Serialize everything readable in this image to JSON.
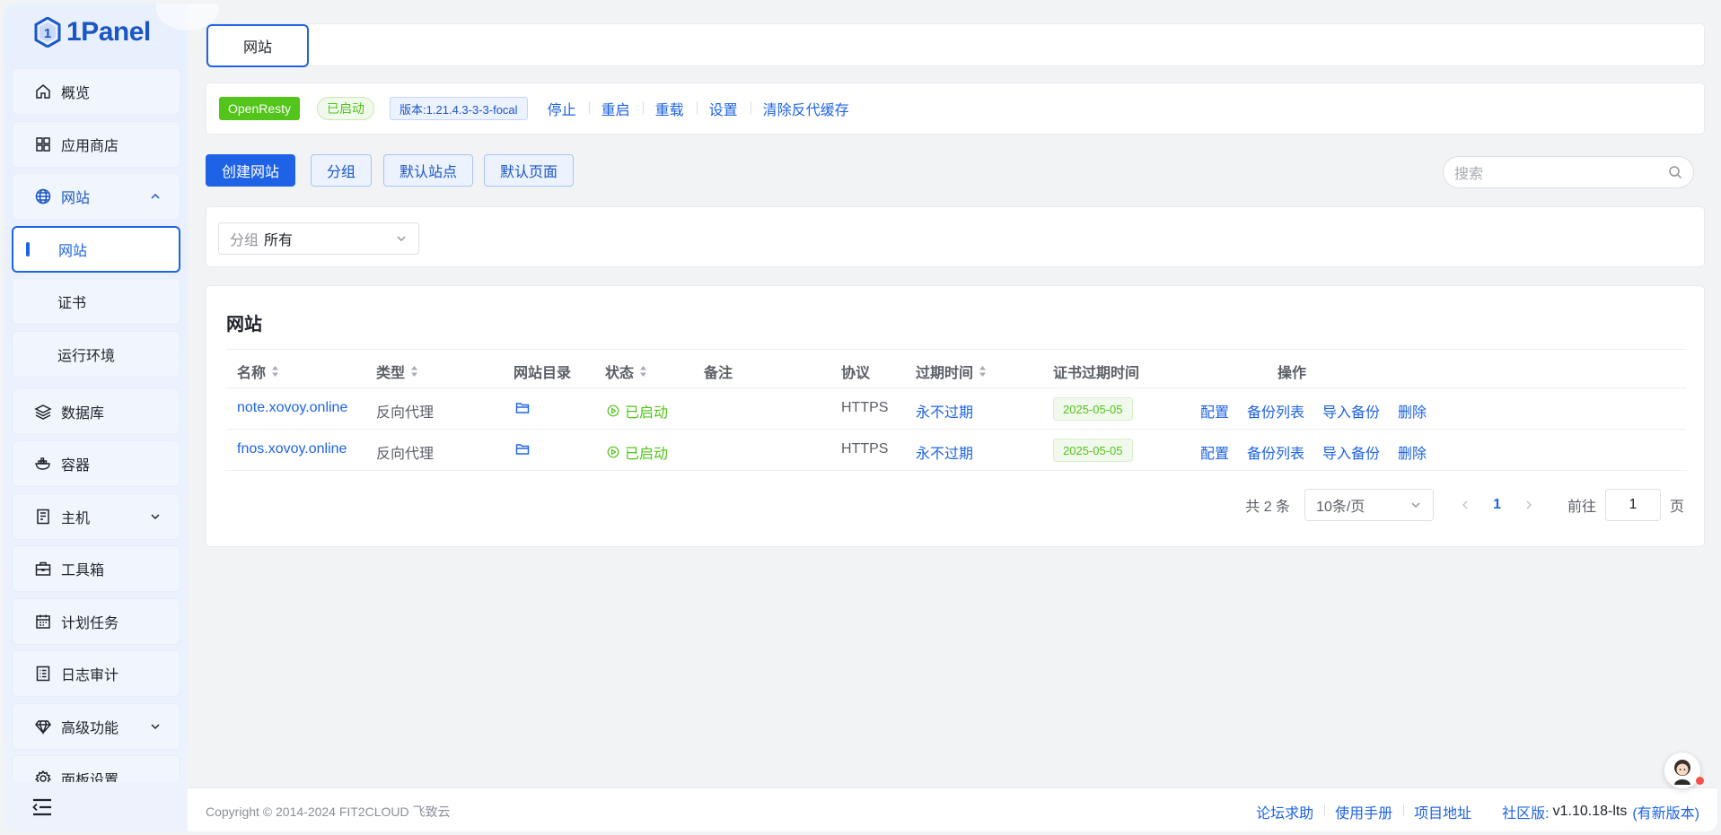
{
  "sidebar": {
    "logo_text": "1Panel",
    "items": [
      {
        "label": "概览",
        "icon": "home-icon"
      },
      {
        "label": "应用商店",
        "icon": "grid-icon"
      },
      {
        "label": "网站",
        "icon": "globe-icon"
      },
      {
        "label": "网站"
      },
      {
        "label": "证书"
      },
      {
        "label": "运行环境"
      },
      {
        "label": "数据库",
        "icon": "layers-icon"
      },
      {
        "label": "容器",
        "icon": "docker-icon"
      },
      {
        "label": "主机",
        "icon": "server-icon"
      },
      {
        "label": "工具箱",
        "icon": "toolbox-icon"
      },
      {
        "label": "计划任务",
        "icon": "calendar-icon"
      },
      {
        "label": "日志审计",
        "icon": "log-icon"
      },
      {
        "label": "高级功能",
        "icon": "diamond-icon"
      },
      {
        "label": "面板设置",
        "icon": "gear-icon"
      }
    ]
  },
  "tabs": {
    "active": "网站"
  },
  "app": {
    "name": "OpenResty",
    "status": "已启动",
    "version": "版本:1.21.4.3-3-3-focal",
    "actions": [
      "停止",
      "重启",
      "重载",
      "设置",
      "清除反代缓存"
    ]
  },
  "toolbar": {
    "create": "创建网站",
    "group": "分组",
    "default_site": "默认站点",
    "default_page": "默认页面",
    "search_placeholder": "搜索"
  },
  "filter": {
    "prefix": "分组",
    "value": "所有"
  },
  "table": {
    "title": "网站",
    "columns": [
      "名称",
      "类型",
      "网站目录",
      "状态",
      "备注",
      "协议",
      "过期时间",
      "证书过期时间",
      "操作"
    ],
    "rows": [
      {
        "name": "note.xovoy.online",
        "type": "反向代理",
        "status": "已启动",
        "remark": "",
        "protocol": "HTTPS",
        "expire": "永不过期",
        "cert_expire": "2025-05-05"
      },
      {
        "name": "fnos.xovoy.online",
        "type": "反向代理",
        "status": "已启动",
        "remark": "",
        "protocol": "HTTPS",
        "expire": "永不过期",
        "cert_expire": "2025-05-05"
      }
    ],
    "row_actions": [
      "配置",
      "备份列表",
      "导入备份",
      "删除"
    ]
  },
  "pagination": {
    "total": "共 2 条",
    "page_size": "10条/页",
    "current": "1",
    "goto_prefix": "前往",
    "goto_value": "1",
    "goto_suffix": "页"
  },
  "footer": {
    "copyright": "Copyright © 2014-2024 FIT2CLOUD 飞致云",
    "links": [
      "论坛求助",
      "使用手册",
      "项目地址"
    ],
    "edition": "社区版:",
    "version": "v1.10.18-lts",
    "new_version": "(有新版本)"
  },
  "colors": {
    "primary": "#1e63e6",
    "success": "#52c41a",
    "background": "#f2f3f5"
  }
}
